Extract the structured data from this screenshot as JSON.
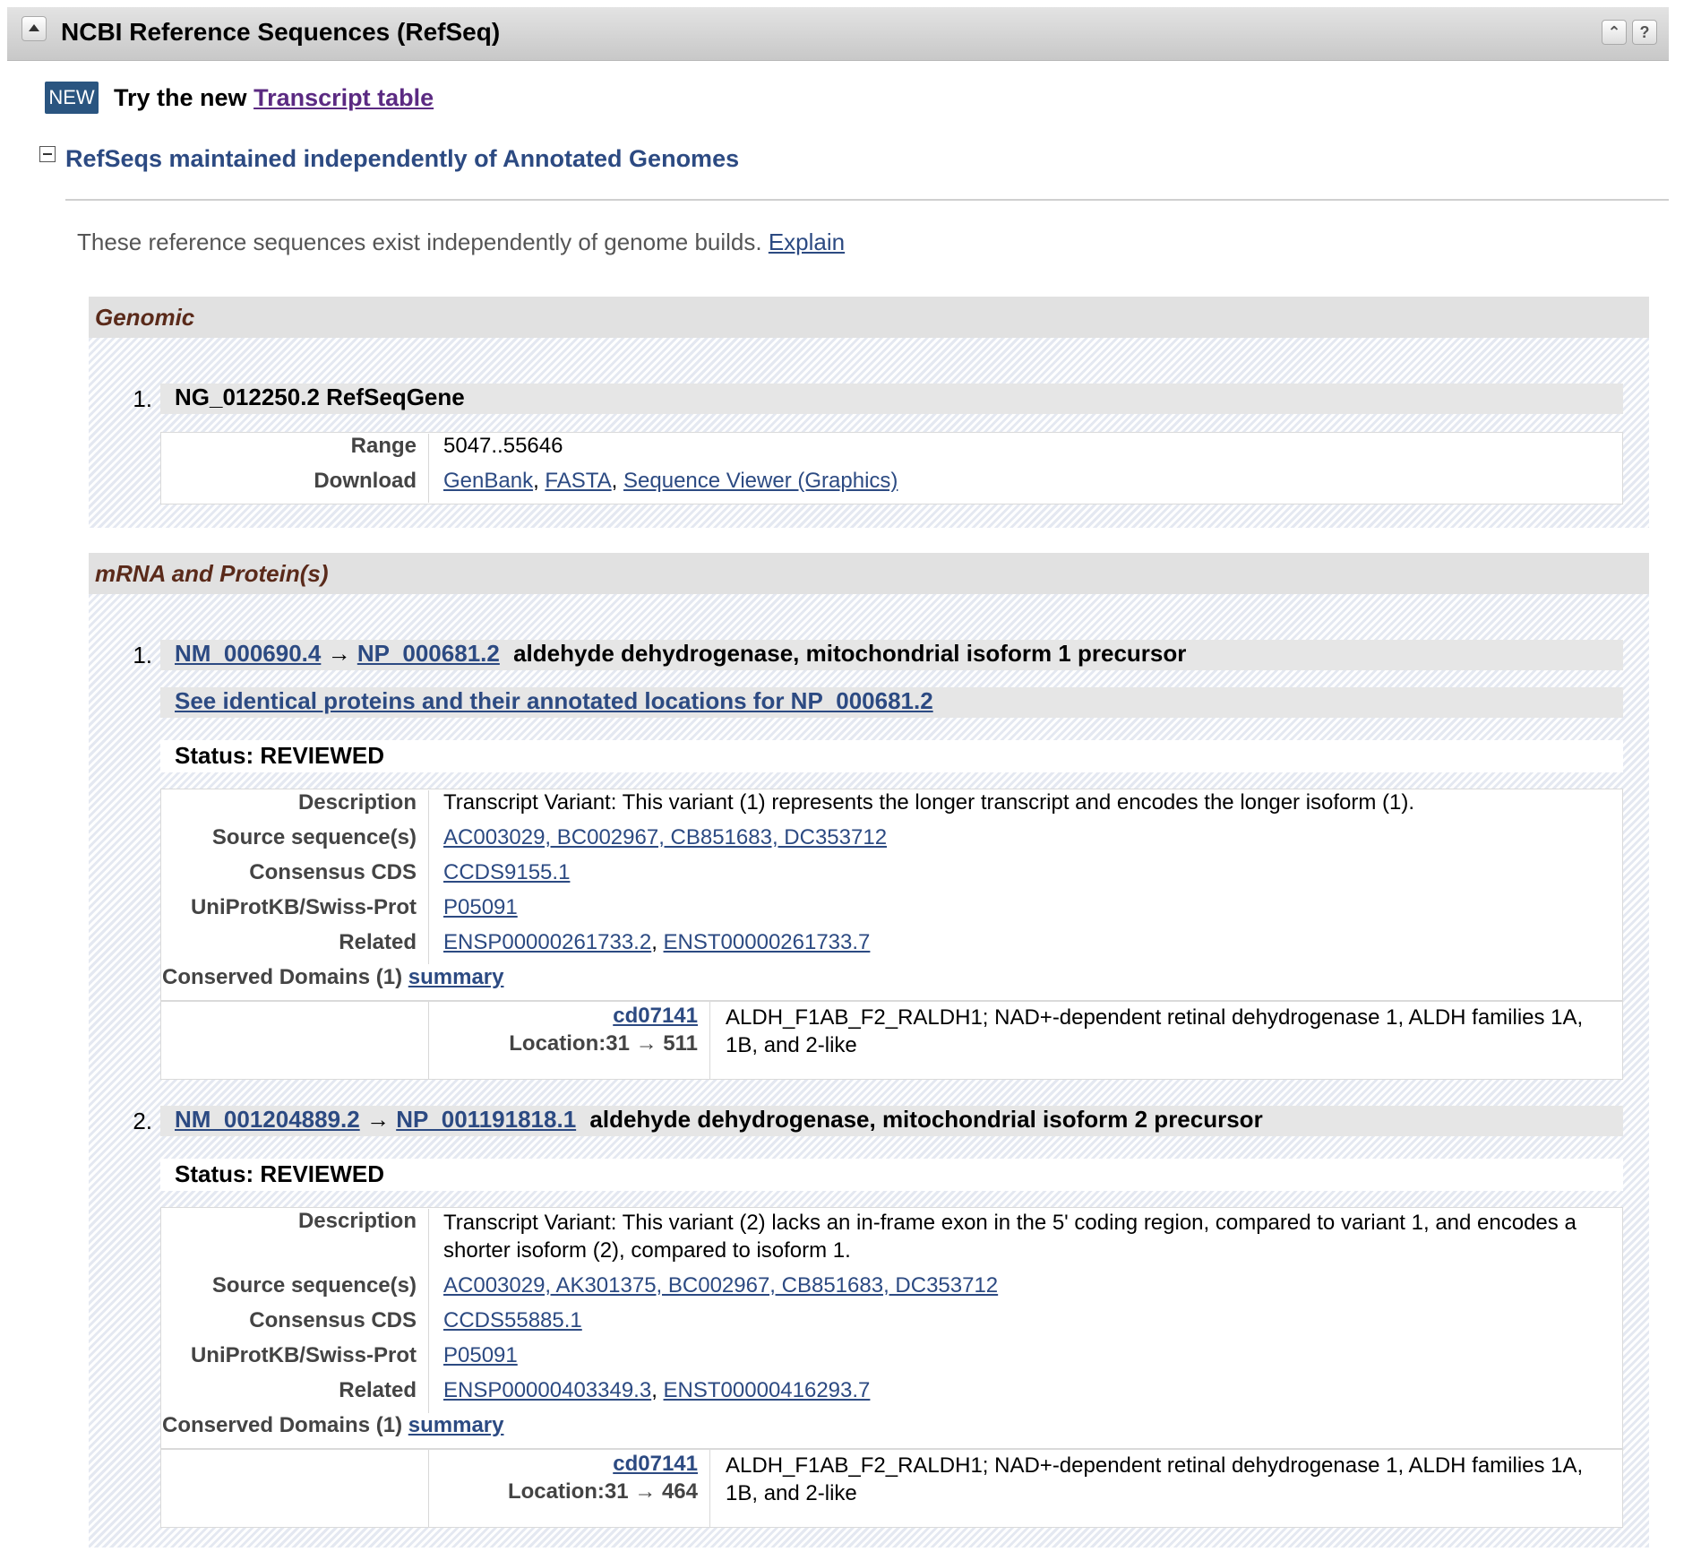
{
  "header": {
    "title": "NCBI Reference Sequences (RefSeq)",
    "scroll_top_glyph": "⌃",
    "help_glyph": "?"
  },
  "new_feature": {
    "badge": "NEW",
    "text": "Try the new",
    "link": "Transcript table"
  },
  "section": {
    "title": "RefSeqs maintained independently of Annotated Genomes",
    "intro_text": "These reference sequences exist independently of genome builds.",
    "explain_link": "Explain"
  },
  "genomic": {
    "heading": "Genomic",
    "items": [
      {
        "number": "1.",
        "title": "NG_012250.2 RefSeqGene",
        "range_label": "Range",
        "range": "5047..55646",
        "download_label": "Download",
        "downloads": [
          "GenBank",
          "FASTA",
          "Sequence Viewer (Graphics)"
        ],
        "separator": ","
      }
    ]
  },
  "mrna": {
    "heading": "mRNA and Protein(s)",
    "arrow": "→",
    "items": [
      {
        "number": "1.",
        "mrna_acc": "NM_000690.4",
        "protein_acc": "NP_000681.2",
        "name": "aldehyde dehydrogenase, mitochondrial isoform 1 precursor",
        "identical_link": "See identical proteins and their annotated locations for NP_000681.2",
        "status": "Status: REVIEWED",
        "labels": {
          "description": "Description",
          "source": "Source sequence(s)",
          "ccds": "Consensus CDS",
          "uniprot": "UniProtKB/Swiss-Prot",
          "related": "Related"
        },
        "description": "Transcript Variant: This variant (1) represents the longer transcript and encodes the longer isoform (1).",
        "source_sequences": "AC003029, BC002967, CB851683, DC353712",
        "consensus_cds": "CCDS9155.1",
        "uniprot": "P05091",
        "related": [
          "ENSP00000261733.2",
          "ENST00000261733.7"
        ],
        "conserved_domains_label": "Conserved Domains (1)",
        "summary_link": "summary",
        "domain": {
          "id": "cd07141",
          "location": "Location:31 → 511",
          "description": "ALDH_F1AB_F2_RALDH1; NAD+-dependent retinal dehydrogenase 1, ALDH families 1A, 1B, and 2-like"
        }
      },
      {
        "number": "2.",
        "mrna_acc": "NM_001204889.2",
        "protein_acc": "NP_001191818.1",
        "name": "aldehyde dehydrogenase, mitochondrial isoform 2 precursor",
        "status": "Status: REVIEWED",
        "labels": {
          "description": "Description",
          "source": "Source sequence(s)",
          "ccds": "Consensus CDS",
          "uniprot": "UniProtKB/Swiss-Prot",
          "related": "Related"
        },
        "description": "Transcript Variant: This variant (2) lacks an in-frame exon in the 5' coding region, compared to variant 1, and encodes a shorter isoform (2), compared to isoform 1.",
        "source_sequences": "AC003029, AK301375, BC002967, CB851683, DC353712",
        "consensus_cds": "CCDS55885.1",
        "uniprot": "P05091",
        "related": [
          "ENSP00000403349.3",
          "ENST00000416293.7"
        ],
        "conserved_domains_label": "Conserved Domains (1)",
        "summary_link": "summary",
        "domain": {
          "id": "cd07141",
          "location": "Location:31 → 464",
          "description": "ALDH_F1AB_F2_RALDH1; NAD+-dependent retinal dehydrogenase 1, ALDH families 1A, 1B, and 2-like"
        }
      }
    ]
  }
}
